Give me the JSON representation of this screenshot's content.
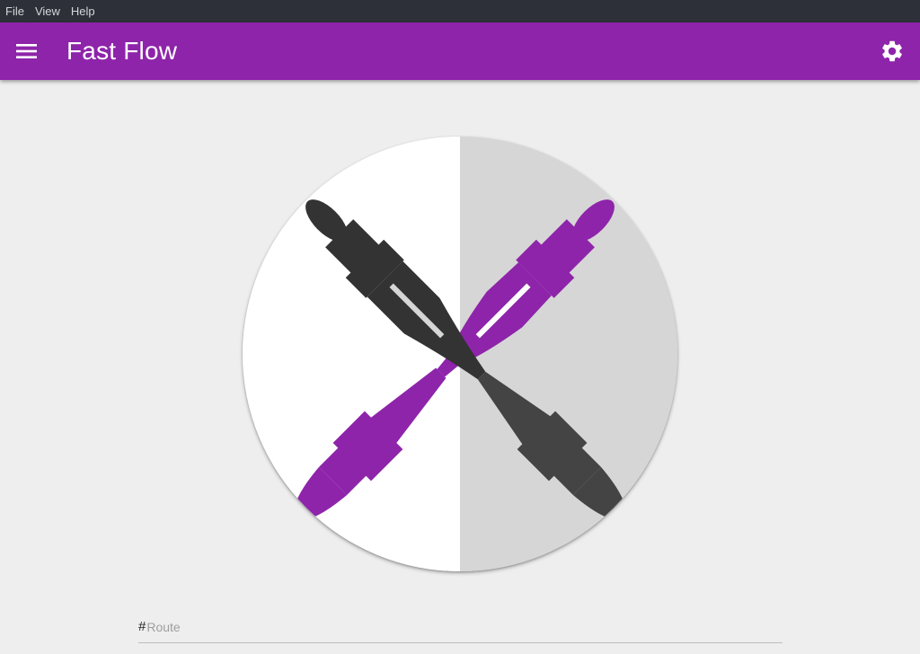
{
  "menubar": {
    "items": [
      "File",
      "View",
      "Help"
    ]
  },
  "appbar": {
    "title": "Fast Flow",
    "menu_icon": "hamburger-menu-icon",
    "settings_icon": "gear-icon",
    "color": "#8e24aa"
  },
  "logo": {
    "description_icon": "crossed-pens-logo",
    "left_color": "#ffffff",
    "right_color": "#d6d6d6",
    "pen_purple": "#8e24aa",
    "pen_dark": "#333333"
  },
  "route": {
    "prefix": "#",
    "placeholder": "Route",
    "value": ""
  }
}
